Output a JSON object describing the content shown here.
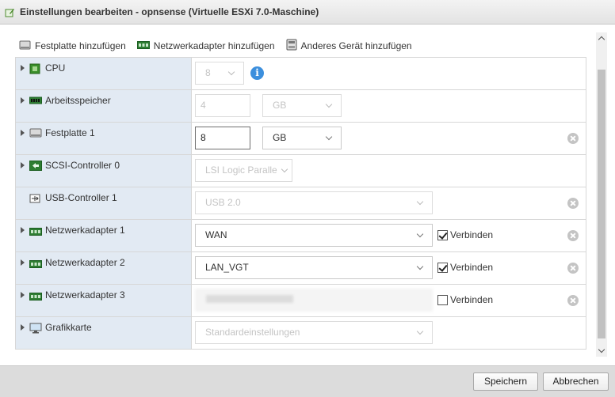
{
  "window": {
    "title": "Einstellungen bearbeiten - opnsense (Virtuelle ESXi 7.0-Maschine)"
  },
  "toolbar": {
    "add_disk": "Festplatte hinzufügen",
    "add_network": "Netzwerkadapter hinzufügen",
    "add_other": "Anderes Gerät hinzufügen"
  },
  "devices": {
    "cpu": {
      "label": "CPU",
      "value": "8"
    },
    "memory": {
      "label": "Arbeitsspeicher",
      "value": "4",
      "unit": "GB"
    },
    "disk1": {
      "label": "Festplatte 1",
      "value": "8",
      "unit": "GB"
    },
    "scsi": {
      "label": "SCSI-Controller 0",
      "value": "LSI Logic Paralle"
    },
    "usb": {
      "label": "USB-Controller 1",
      "value": "USB 2.0"
    },
    "nic1": {
      "label": "Netzwerkadapter 1",
      "value": "WAN",
      "connect_label": "Verbinden",
      "connected": true
    },
    "nic2": {
      "label": "Netzwerkadapter 2",
      "value": "LAN_VGT",
      "connect_label": "Verbinden",
      "connected": true
    },
    "nic3": {
      "label": "Netzwerkadapter 3",
      "connect_label": "Verbinden",
      "connected": false
    },
    "gpu": {
      "label": "Grafikkarte",
      "value": "Standardeinstellungen"
    }
  },
  "footer": {
    "save": "Speichern",
    "cancel": "Abbrechen"
  },
  "colors": {
    "label_column": "#e2eaf3",
    "info_icon": "#3c8fdd",
    "footer": "#dcdcdc"
  }
}
